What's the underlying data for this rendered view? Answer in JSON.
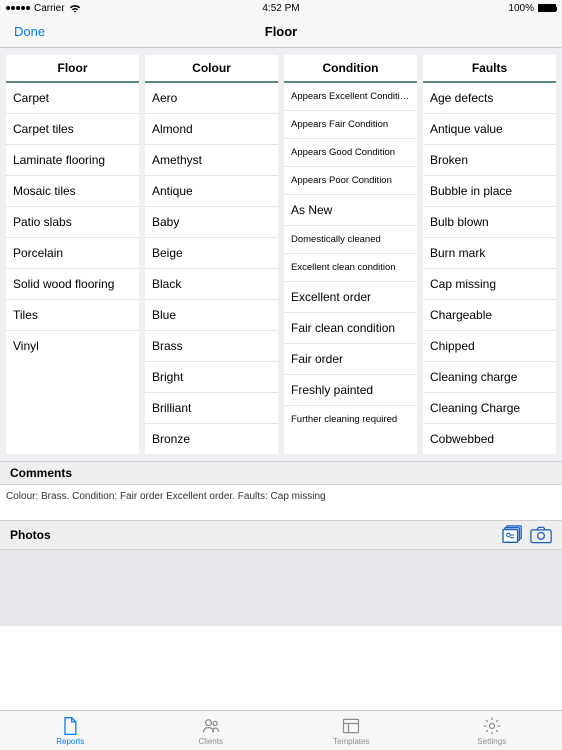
{
  "statusBar": {
    "carrier": "Carrier",
    "time": "4:52 PM",
    "battery": "100%"
  },
  "nav": {
    "done": "Done",
    "title": "Floor"
  },
  "columns": [
    {
      "header": "Floor",
      "items": [
        {
          "label": "Carpet"
        },
        {
          "label": "Carpet tiles"
        },
        {
          "label": "Laminate flooring"
        },
        {
          "label": "Mosaic tiles"
        },
        {
          "label": "Patio slabs"
        },
        {
          "label": "Porcelain"
        },
        {
          "label": "Solid wood flooring"
        },
        {
          "label": "Tiles"
        },
        {
          "label": "Vinyl"
        }
      ]
    },
    {
      "header": "Colour",
      "items": [
        {
          "label": "Aero"
        },
        {
          "label": "Almond"
        },
        {
          "label": "Amethyst"
        },
        {
          "label": "Antique"
        },
        {
          "label": "Baby"
        },
        {
          "label": "Beige"
        },
        {
          "label": "Black"
        },
        {
          "label": "Blue"
        },
        {
          "label": "Brass"
        },
        {
          "label": "Bright"
        },
        {
          "label": "Brilliant"
        },
        {
          "label": "Bronze"
        }
      ]
    },
    {
      "header": "Condition",
      "items": [
        {
          "label": "Appears Excellent Condition",
          "small": true
        },
        {
          "label": "Appears Fair Condition",
          "small": true
        },
        {
          "label": "Appears Good Condition",
          "small": true
        },
        {
          "label": "Appears Poor Condition",
          "small": true
        },
        {
          "label": "As New"
        },
        {
          "label": "Domestically cleaned",
          "small": true
        },
        {
          "label": "Excellent clean condition",
          "small": true
        },
        {
          "label": "Excellent order"
        },
        {
          "label": "Fair clean condition"
        },
        {
          "label": "Fair order"
        },
        {
          "label": "Freshly painted"
        },
        {
          "label": "Further cleaning required",
          "small": true
        }
      ]
    },
    {
      "header": "Faults",
      "items": [
        {
          "label": "Age defects"
        },
        {
          "label": "Antique value"
        },
        {
          "label": "Broken"
        },
        {
          "label": "Bubble in place"
        },
        {
          "label": "Bulb blown"
        },
        {
          "label": "Burn mark"
        },
        {
          "label": "Cap missing"
        },
        {
          "label": "Chargeable"
        },
        {
          "label": "Chipped"
        },
        {
          "label": "Cleaning charge"
        },
        {
          "label": "Cleaning Charge"
        },
        {
          "label": "Cobwebbed"
        }
      ]
    }
  ],
  "comments": {
    "header": "Comments",
    "body": "Colour: Brass. Condition: Fair order Excellent order. Faults: Cap missing"
  },
  "photos": {
    "header": "Photos"
  },
  "tabs": [
    {
      "label": "Reports",
      "active": true
    },
    {
      "label": "Clients"
    },
    {
      "label": "Templates"
    },
    {
      "label": "Settings"
    }
  ]
}
